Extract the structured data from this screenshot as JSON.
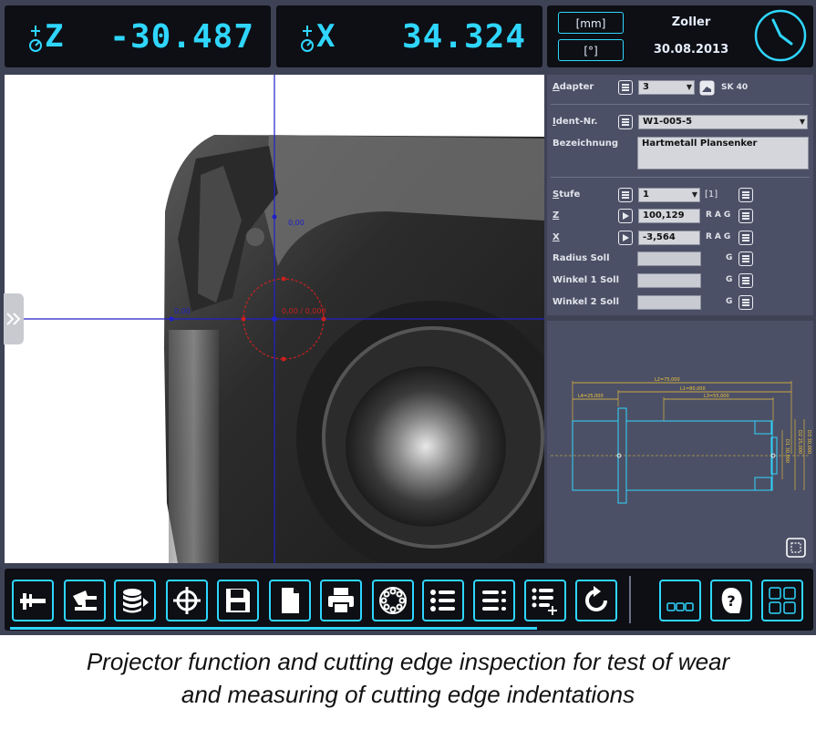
{
  "readouts": {
    "z": {
      "axis": "Z",
      "value": "-30.487"
    },
    "x": {
      "axis": "X",
      "value": "34.324"
    }
  },
  "info": {
    "unit_length": "[mm]",
    "unit_angle": "[°]",
    "user": "Zoller",
    "date": "30.08.2013"
  },
  "camera": {
    "label_top": "0,00",
    "label_left": "0,00",
    "label_center": "0,00 / 0,000"
  },
  "form": {
    "adapter_label_u": "A",
    "adapter_label_rest": "dapter",
    "adapter_value": "3",
    "adapter_type": "SK 40",
    "ident_label_u": "I",
    "ident_label_rest": "dent-Nr.",
    "ident_value": "W1-005-5",
    "bez_label": "Bezeichnung",
    "bez_value": "Hartmetall Plansenker",
    "stufe_label_u": "S",
    "stufe_label_rest": "tufe",
    "stufe_value": "1",
    "stufe_count": "[1]",
    "z_label": "Z",
    "z_value": "100,129",
    "z_tags": "RAG",
    "x_label": "X",
    "x_value": "-3,564",
    "x_tags": "RAG",
    "radius_label": "Radius Soll",
    "radius_tag": "G",
    "winkel1_label": "Winkel 1 Soll",
    "winkel1_tag": "G",
    "winkel2_label": "Winkel 2 Soll",
    "winkel2_tag": "G"
  },
  "drawing": {
    "l2": "L2=75,000",
    "l1": "L1=80,000",
    "l3": "L3=55,000",
    "l4": "L4=25,000",
    "d1": "D1 30,000",
    "d2": "D2 25,000",
    "d3": "D3 30,000"
  },
  "toolbar": {
    "buttons": [
      "caliper-icon",
      "tool-setting-icon",
      "database-icon",
      "crosshair-icon",
      "save-icon",
      "document-icon",
      "print-icon",
      "turret-icon",
      "list-icon",
      "list-detail-icon",
      "list-add-icon",
      "refresh-icon"
    ],
    "right_buttons": [
      "more-icon",
      "help-icon",
      "apps-icon"
    ],
    "progress": 0.66
  },
  "caption": {
    "line1": "Projector function and cutting edge inspection for test of wear",
    "line2": "and measuring of cutting edge indentations"
  },
  "colors": {
    "accent": "#2fd6ff",
    "panel": "#4c5066",
    "background": "#3e4255",
    "dimension": "#f0c43a"
  }
}
